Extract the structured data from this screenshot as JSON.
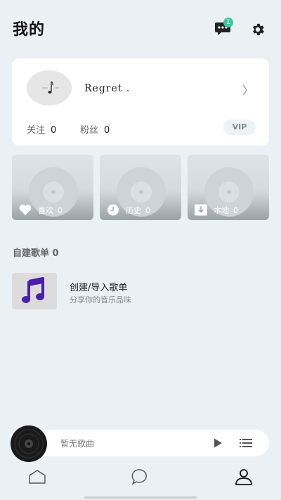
{
  "header": {
    "title": "我的",
    "message_badge_count": "1"
  },
  "profile": {
    "username": "Regret .",
    "stats": [
      {
        "label": "关注",
        "value": "0"
      },
      {
        "label": "粉丝",
        "value": "0"
      }
    ],
    "vip_label": "VIP"
  },
  "tiles": [
    {
      "label": "喜欢",
      "count": "0",
      "icon": "heart-icon"
    },
    {
      "label": "历史",
      "count": "0",
      "icon": "clock-icon"
    },
    {
      "label": "本地",
      "count": "0",
      "icon": "download-icon"
    }
  ],
  "playlists": {
    "section_title": "自建歌单 0",
    "create_title": "创建/导入歌单",
    "create_subtitle": "分享你的音乐品味"
  },
  "player": {
    "empty_text": "暂无歌曲"
  },
  "nav": [
    {
      "name": "home",
      "icon": "home-icon"
    },
    {
      "name": "discover",
      "icon": "chat-bubble-icon"
    },
    {
      "name": "profile",
      "icon": "user-icon",
      "active": true
    }
  ],
  "colors": {
    "background": "#eaf0f3",
    "accent": "#3cc7a1",
    "music_icon": "#4b1fa8"
  }
}
